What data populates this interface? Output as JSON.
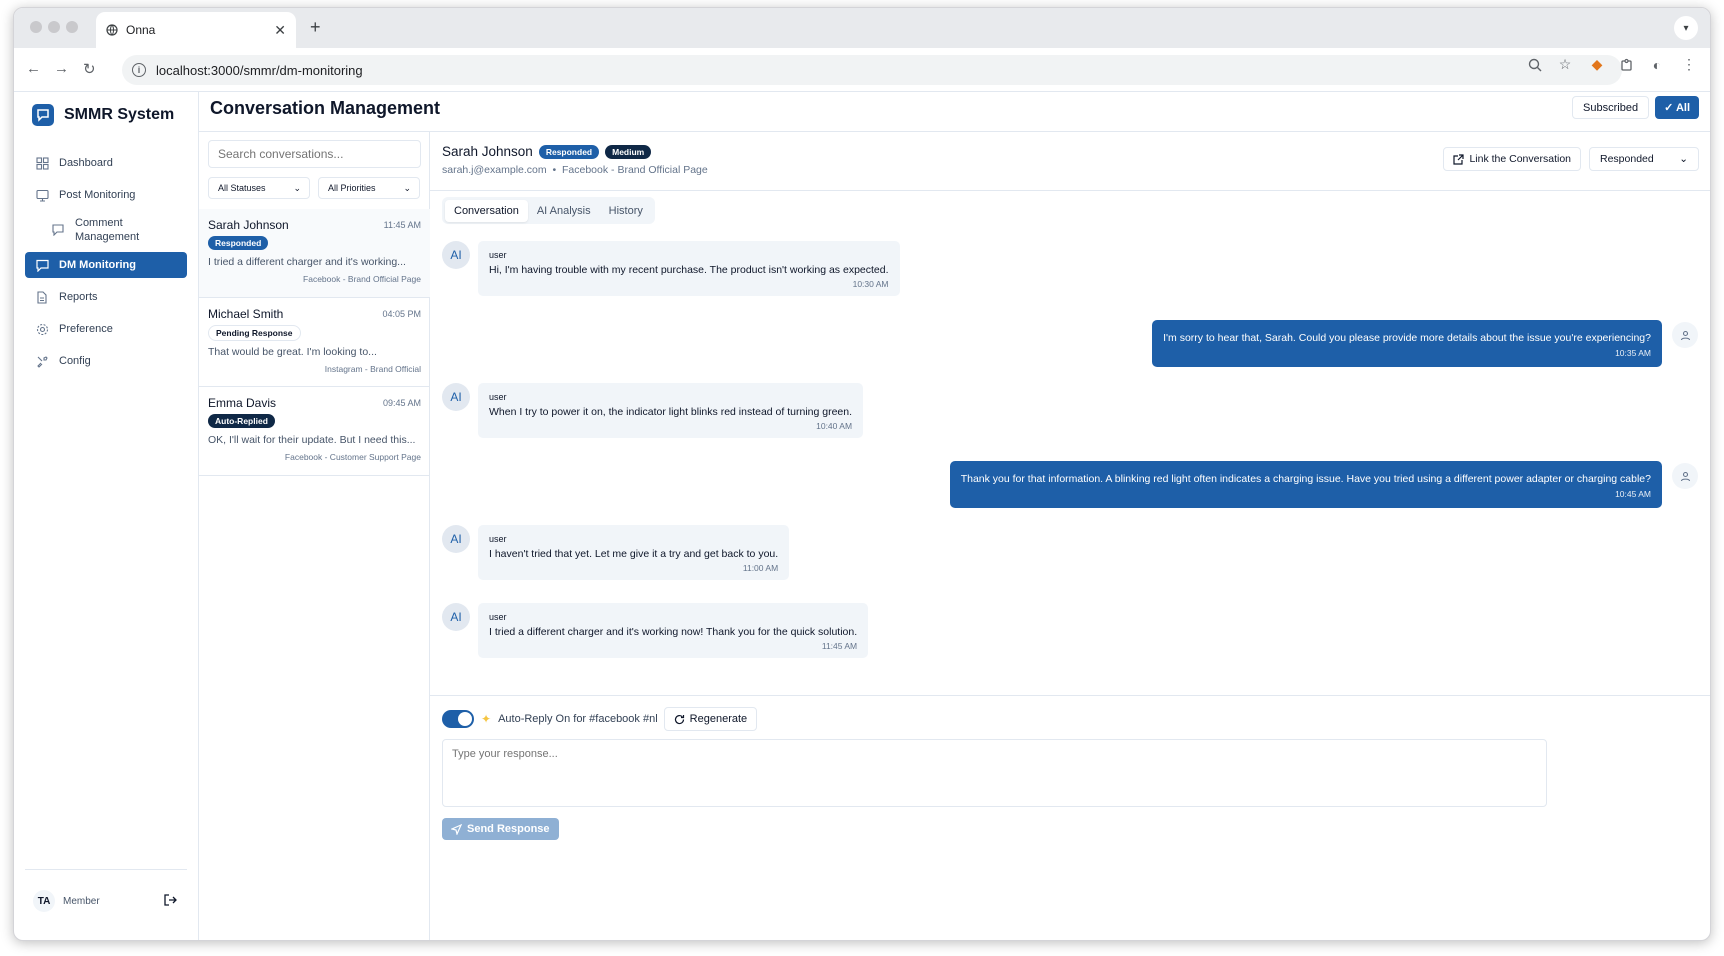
{
  "browser": {
    "tab_title": "Onna",
    "url": "localhost:3000/smmr/dm-monitoring",
    "new_tab": "+",
    "close": "✕"
  },
  "app": {
    "brand": "SMMR System",
    "page_title": "Conversation Management"
  },
  "header": {
    "subscribed_label": "Subscribed",
    "all_label": "✓ All"
  },
  "sidebar": {
    "items": [
      {
        "label": "Dashboard",
        "icon": "dashboard-icon"
      },
      {
        "label": "Post Monitoring",
        "icon": "monitor-icon"
      },
      {
        "label": "Comment\nManagement",
        "icon": "comment-icon"
      },
      {
        "label": "DM Monitoring",
        "icon": "message-icon"
      },
      {
        "label": "Reports",
        "icon": "file-icon"
      },
      {
        "label": "Preference",
        "icon": "gear-icon"
      },
      {
        "label": "Config",
        "icon": "config-icon"
      }
    ],
    "footer": {
      "initials": "TA",
      "role": "Member"
    }
  },
  "list": {
    "search_placeholder": "Search conversations...",
    "status_filter": "All Statuses",
    "priority_filter": "All Priorities",
    "conversations": [
      {
        "name": "Sarah Johnson",
        "time": "11:45 AM",
        "status": "Responded",
        "preview": "I tried a different charger and it's working...",
        "source": "Facebook - Brand Official Page"
      },
      {
        "name": "Michael Smith",
        "time": "04:05 PM",
        "status": "Pending Response",
        "preview": "That would be great. I'm looking to...",
        "source": "Instagram - Brand Official"
      },
      {
        "name": "Emma Davis",
        "time": "09:45 AM",
        "status": "Auto-Replied",
        "preview": "OK, I'll wait for their update. But I need this...",
        "source": "Facebook - Customer Support Page"
      }
    ]
  },
  "detail": {
    "contact_name": "Sarah Johnson",
    "status_badge": "Responded",
    "priority_badge": "Medium",
    "email": "sarah.j@example.com",
    "separator": "•",
    "source": "Facebook - Brand Official Page",
    "link_label": "Link the Conversation",
    "status_select": "Responded",
    "tabs": [
      "Conversation",
      "AI Analysis",
      "History"
    ],
    "ai_initials": "AI",
    "messages": [
      {
        "role": "user",
        "who": "user",
        "text": "Hi, I'm having trouble with my recent purchase. The product isn't working as expected.",
        "time": "10:30 AM"
      },
      {
        "role": "agent",
        "text": "I'm sorry to hear that, Sarah. Could you please provide more details about the issue you're experiencing?",
        "time": "10:35 AM"
      },
      {
        "role": "user",
        "who": "user",
        "text": "When I try to power it on, the indicator light blinks red instead of turning green.",
        "time": "10:40 AM"
      },
      {
        "role": "agent",
        "text": "Thank you for that information. A blinking red light often indicates a charging issue. Have you tried using a different power adapter or charging cable?",
        "time": "10:45 AM"
      },
      {
        "role": "user",
        "who": "user",
        "text": "I haven't tried that yet. Let me give it a try and get back to you.",
        "time": "11:00 AM"
      },
      {
        "role": "user",
        "who": "user",
        "text": "I tried a different charger and it's working now! Thank you for the quick solution.",
        "time": "11:45 AM"
      }
    ]
  },
  "composer": {
    "auto_reply_label": "Auto-Reply On for #facebook #nl",
    "regenerate_label": "Regenerate",
    "placeholder": "Type your response...",
    "send_label": "Send Response"
  },
  "colors": {
    "primary": "#1e5fa8",
    "dark_badge": "#0f2846",
    "send_disabled": "#8fb0d4"
  }
}
